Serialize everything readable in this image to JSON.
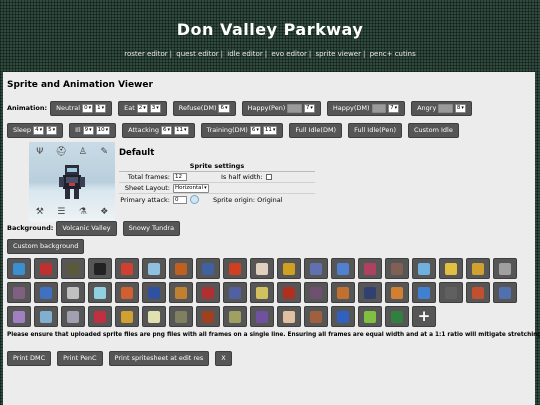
{
  "site": {
    "title": "Don Valley Parkway",
    "nav": [
      "roster editor",
      "quest editor",
      "idle editor",
      "evo editor",
      "sprite viewer",
      "penc+ cutins"
    ],
    "separator": "|"
  },
  "viewer": {
    "title": "Sprite and Animation Viewer",
    "animation_label": "Animation:",
    "animations_row1": [
      {
        "label": "Neutral",
        "a": "0",
        "b": "1"
      },
      {
        "label": "Eat",
        "a": "2",
        "b": "3"
      },
      {
        "label": "Refuse(DM)",
        "a": "6"
      },
      {
        "label": "Happy(Pen)",
        "a": "",
        "b": "7",
        "grey": true
      },
      {
        "label": "Happy(DM)",
        "a": "",
        "b": "7",
        "grey": true
      },
      {
        "label": "Angry",
        "a": "",
        "b": "8",
        "grey": true
      }
    ],
    "animations_row2": [
      {
        "label": "Sleep",
        "a": "4",
        "b": "5"
      },
      {
        "label": "Ill",
        "a": "9",
        "b": "10"
      },
      {
        "label": "Attacking",
        "a": "6",
        "b": "11"
      },
      {
        "label": "Training(DM)",
        "a": "6",
        "b": "11"
      },
      {
        "label": "Full Idle(DM)"
      },
      {
        "label": "Full Idle(Pen)"
      },
      {
        "label": "Custom Idle"
      }
    ],
    "sprite_name": "Default",
    "settings": {
      "title": "Sprite settings",
      "total_frames_label": "Total frames:",
      "total_frames_value": "12",
      "half_width_label": "Is half width:",
      "sheet_layout_label": "Sheet Layout:",
      "sheet_layout_value": "Horizontal",
      "primary_attack_label": "Primary attack:",
      "primary_attack_value": "0",
      "sprite_origin_label": "Sprite origin: Original"
    },
    "background_label": "Background:",
    "backgrounds": [
      "Volcanic Valley",
      "Snowy Tundra"
    ],
    "custom_background": "Custom background",
    "note": "Please ensure that uploaded sprite files are png files with all frames on a single line. Ensuring all frames are equal width and at a 1:1 ratio will mitigate stretching.",
    "bottom_buttons": [
      "Print DMC",
      "Print PenC",
      "Print spritesheet at edit res",
      "X"
    ],
    "plus_label": "+",
    "icon_colors": [
      "#3a8fd0",
      "#c03030",
      "#5a5a3a",
      "#222222",
      "#d04030",
      "#90c0e0",
      "#c06020",
      "#4060a0",
      "#d04020",
      "#e0d0c0",
      "#d0a020",
      "#6070b0",
      "#5080d0",
      "#b04060",
      "#806050",
      "#70b0e0",
      "#e0c040",
      "#d0a030",
      "#a0a0a0",
      "#806080",
      "#4070c0",
      "#c0c0c0",
      "#90d0e0",
      "#d06030",
      "#3050a0",
      "#c08030",
      "#b03030",
      "#5060a0",
      "#d0c060",
      "#b03020",
      "#705070",
      "#c07030",
      "#304070",
      "#d08030",
      "#4080d0",
      "#606060",
      "#c05030",
      "#5070b0",
      "#a080c0",
      "#80b0d0",
      "#a0a0b0",
      "#c03040",
      "#d0a030",
      "#e0e0b0",
      "#808060",
      "#a04020",
      "#a0a060",
      "#7050a0",
      "#e0c0a0",
      "#a06040",
      "#3060c0",
      "#80c040",
      "#308040"
    ]
  }
}
